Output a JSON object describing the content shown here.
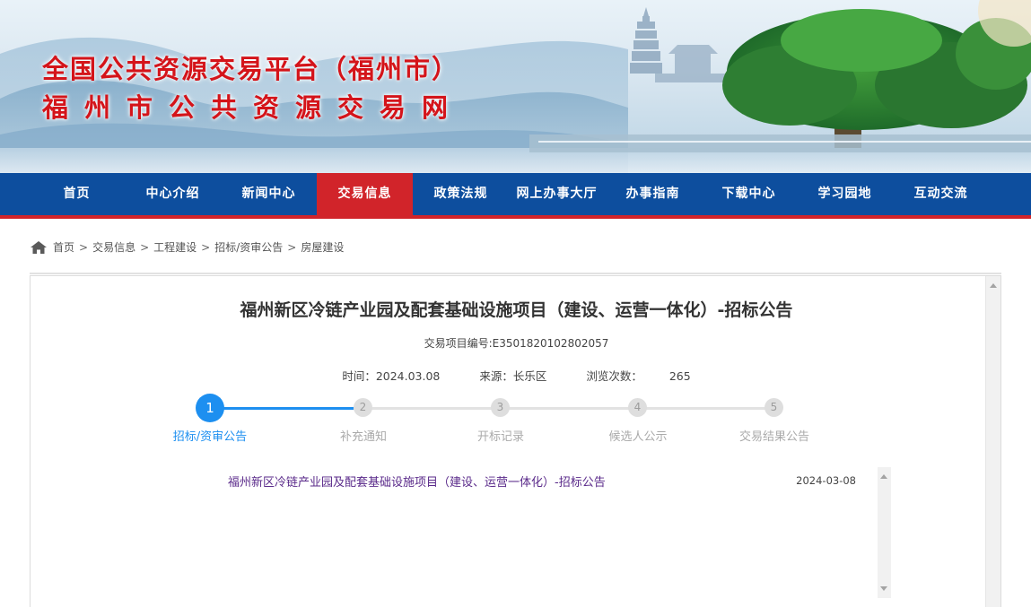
{
  "header": {
    "title": "全国公共资源交易平台（福州市）",
    "subtitle": "福州市公共资源交易网"
  },
  "nav": {
    "items": [
      "首页",
      "中心介绍",
      "新闻中心",
      "交易信息",
      "政策法规",
      "网上办事大厅",
      "办事指南",
      "下载中心",
      "学习园地",
      "互动交流"
    ],
    "active": "交易信息"
  },
  "breadcrumb": [
    "首页",
    "交易信息",
    "工程建设",
    "招标/资审公告",
    "房屋建设"
  ],
  "article": {
    "title": "福州新区冷链产业园及配套基础设施项目（建设、运营一体化）-招标公告",
    "project_code": "交易项目编号:E3501820102802057",
    "time_label": "时间：2024.03.08",
    "source_label": "来源：长乐区",
    "views_label": "浏览次数：",
    "views_value": "265"
  },
  "steps": [
    {
      "num": "1",
      "label": "招标/资审公告",
      "active": true
    },
    {
      "num": "2",
      "label": "补充通知",
      "active": false
    },
    {
      "num": "3",
      "label": "开标记录",
      "active": false
    },
    {
      "num": "4",
      "label": "候选人公示",
      "active": false
    },
    {
      "num": "5",
      "label": "交易结果公告",
      "active": false
    }
  ],
  "announcements": [
    {
      "title": "福州新区冷链产业园及配套基础设施项目（建设、运营一体化）-招标公告",
      "date": "2024-03-08"
    }
  ],
  "colors": {
    "nav_bg": "#0d4e9e",
    "accent_red": "#d1242a",
    "step_active": "#1d8ff0",
    "title_red": "#d4141a"
  }
}
